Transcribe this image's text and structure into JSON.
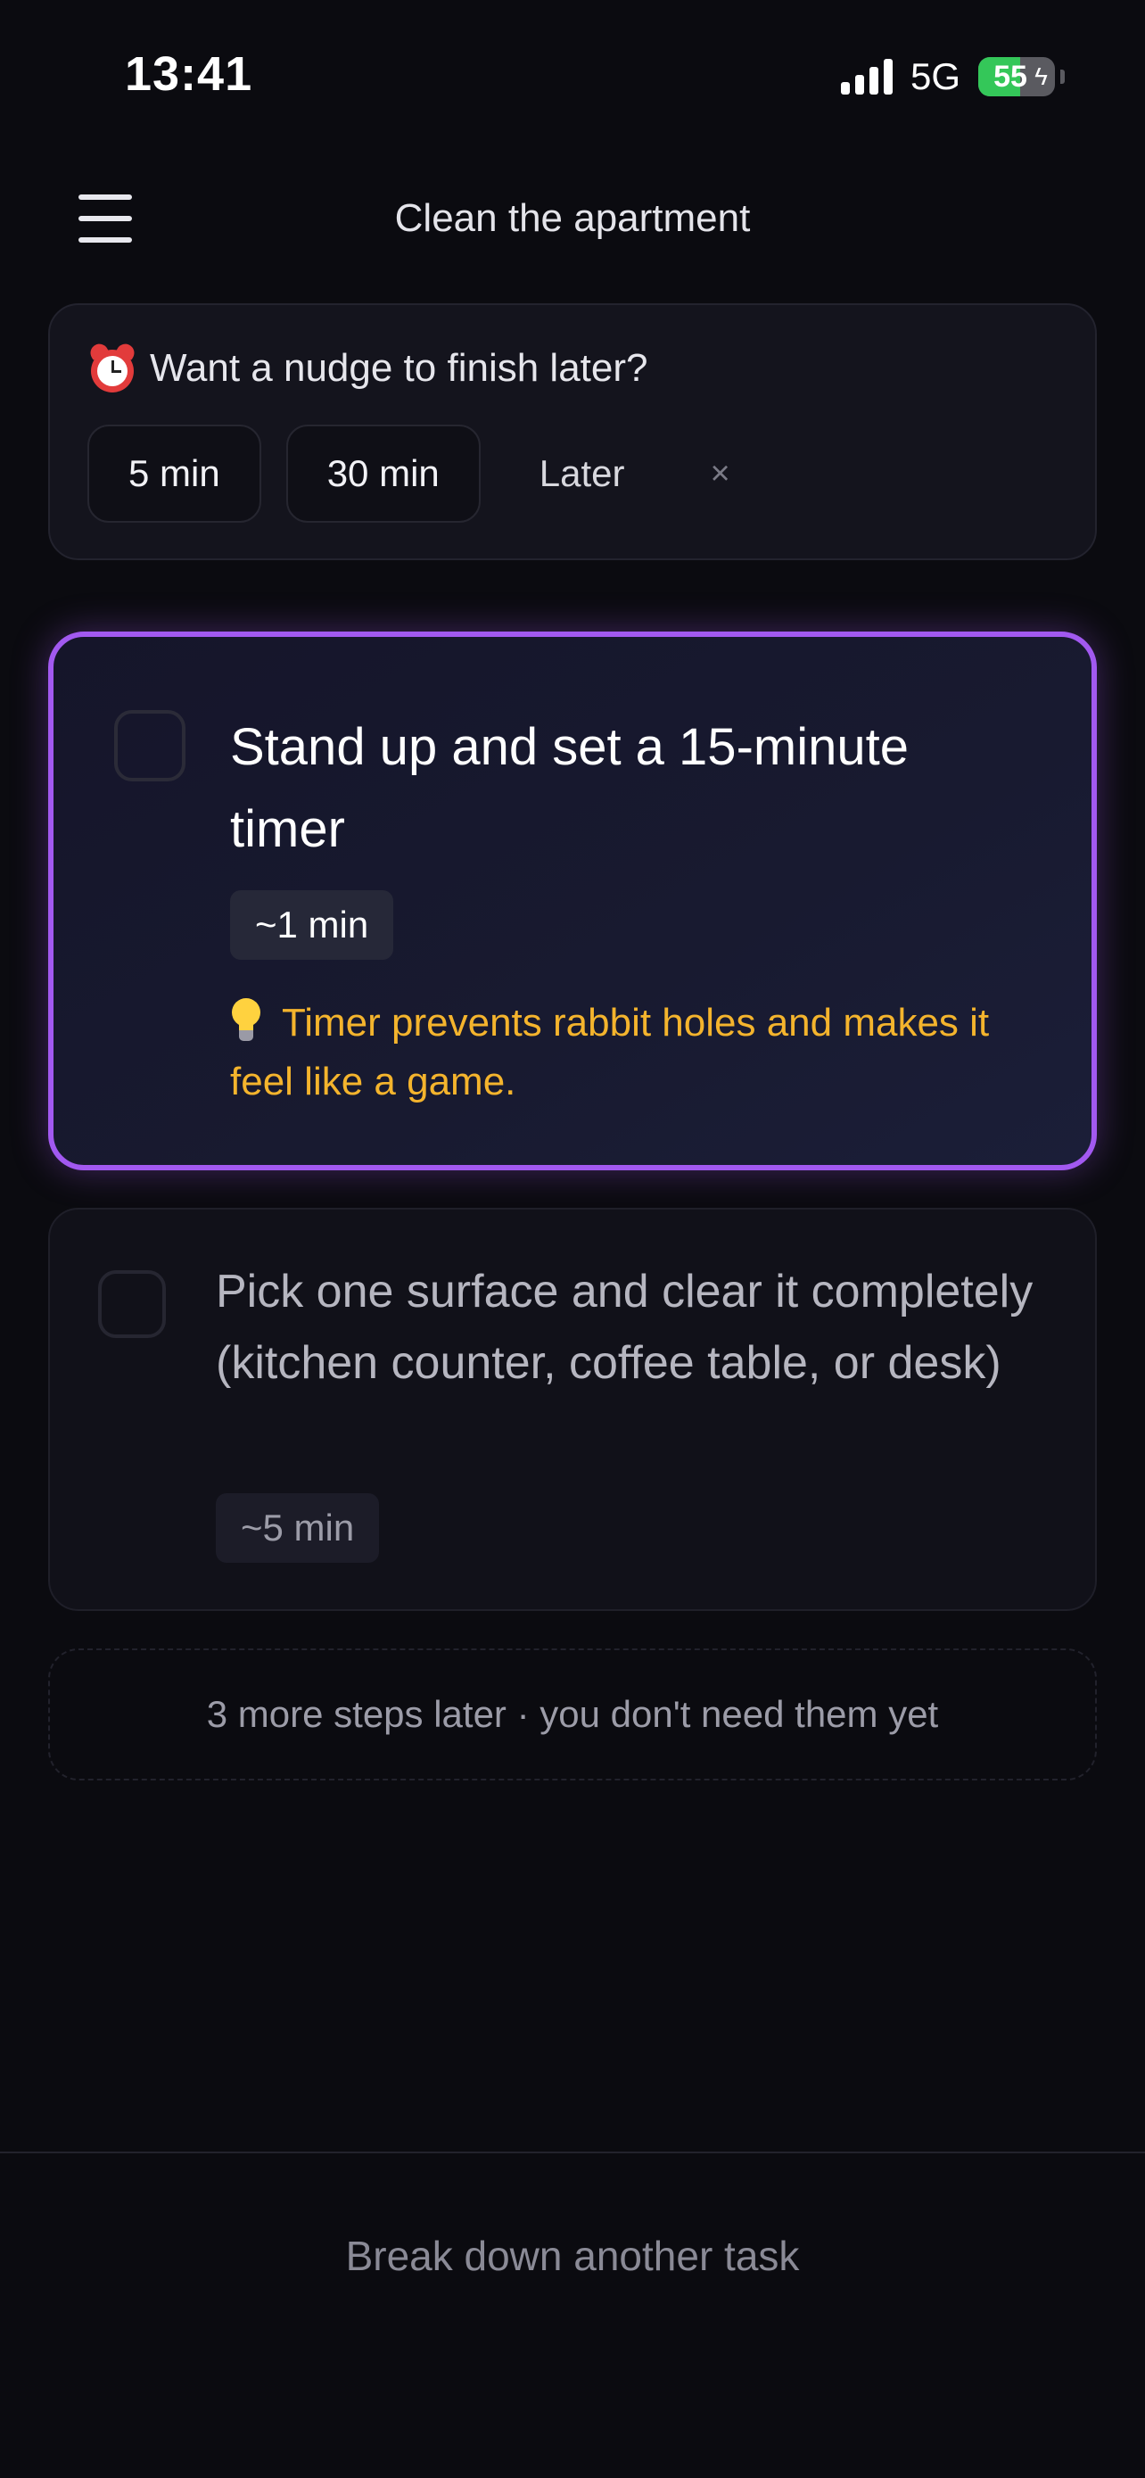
{
  "status_bar": {
    "time": "13:41",
    "network": "5G",
    "battery_percent": "55",
    "battery_level": 0.55,
    "signal_bars": 4,
    "icons": [
      "cellular-signal-icon",
      "battery-charging-icon"
    ]
  },
  "header": {
    "menu_icon": "hamburger-menu-icon",
    "title": "Clean the apartment"
  },
  "nudge": {
    "icon": "alarm-clock-icon",
    "title": "Want a nudge to finish later?",
    "options": [
      "5 min",
      "30 min",
      "Later"
    ],
    "dismiss": "×"
  },
  "steps": {
    "active": {
      "title": "Stand up and set a 15-minute timer",
      "duration": "~1 min",
      "tip_icon": "light-bulb-icon",
      "tip": "Timer prevents rabbit holes and makes it feel like a game.",
      "checked": false
    },
    "next": {
      "title": "Pick one surface and clear it completely (kitchen counter, coffee table, or desk)",
      "duration": "~5 min",
      "checked": false
    }
  },
  "more_steps": "3 more steps later · you don't need them yet",
  "footer": {
    "action_label": "Break down another task"
  },
  "colors": {
    "background": "#0b0b10",
    "accent": "#a259f0",
    "tip": "#f4b42d",
    "battery": "#34c759"
  }
}
